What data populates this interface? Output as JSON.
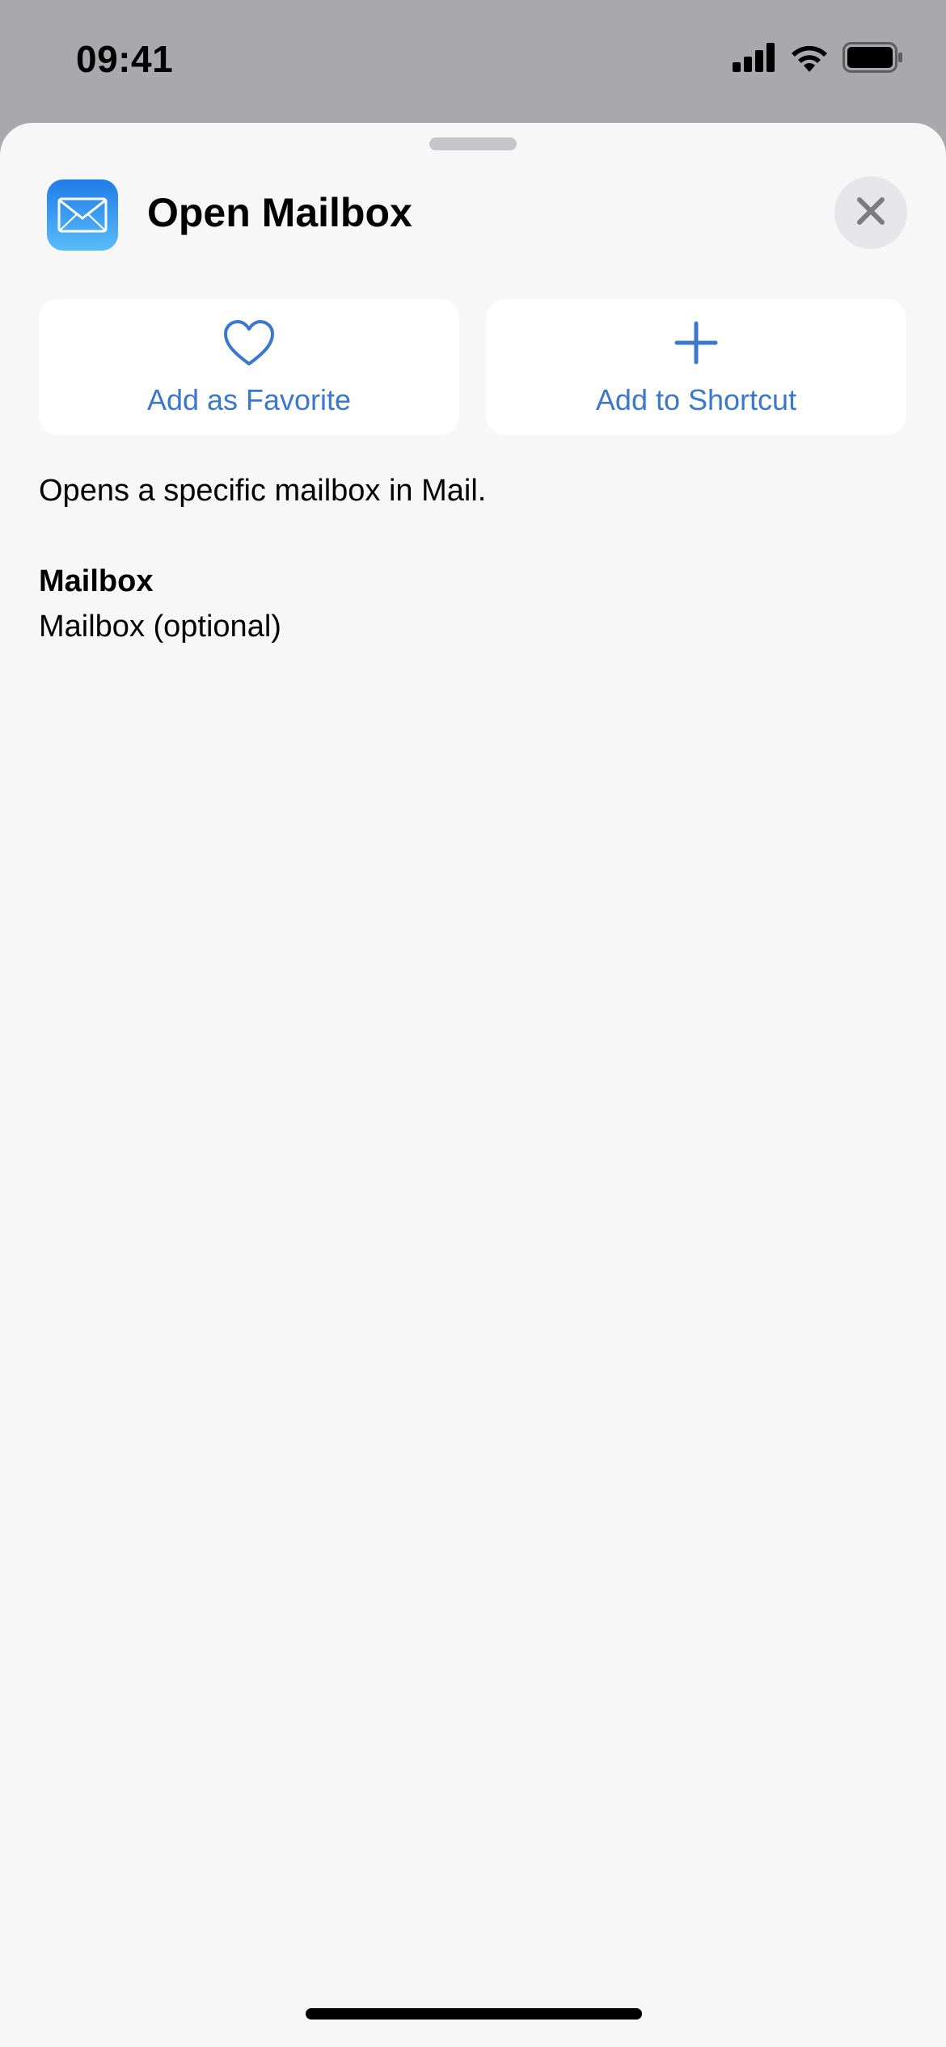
{
  "status_bar": {
    "time": "09:41",
    "icons": [
      "cellular-signal-icon",
      "wifi-icon",
      "battery-icon"
    ]
  },
  "sheet": {
    "app_icon": "mail-icon",
    "title": "Open Mailbox",
    "close_icon": "close-icon",
    "actions": [
      {
        "label": "Add as Favorite",
        "icon": "heart-icon"
      },
      {
        "label": "Add to Shortcut",
        "icon": "plus-icon"
      }
    ],
    "description": "Opens a specific mailbox in Mail.",
    "parameter": {
      "title": "Mailbox",
      "value": "Mailbox (optional)"
    }
  },
  "colors": {
    "accent": "#3a78cc",
    "sheet_background": "#f7f7f7",
    "backdrop": "#a9a9ab"
  }
}
